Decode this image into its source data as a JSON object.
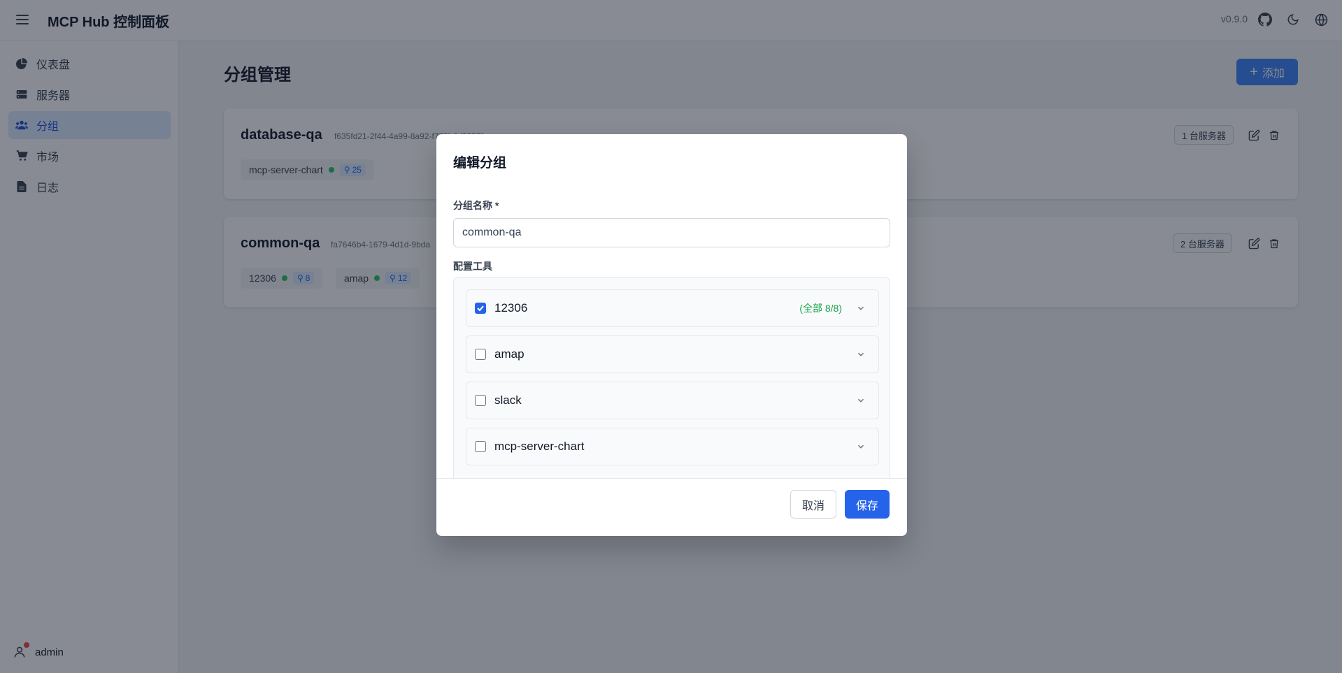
{
  "header": {
    "title": "MCP Hub 控制面板",
    "version": "v0.9.0"
  },
  "sidebar": {
    "items": [
      {
        "label": "仪表盘",
        "icon": "pie-chart-icon"
      },
      {
        "label": "服务器",
        "icon": "server-icon"
      },
      {
        "label": "分组",
        "icon": "users-icon",
        "active": true
      },
      {
        "label": "市场",
        "icon": "cart-icon"
      },
      {
        "label": "日志",
        "icon": "document-icon"
      }
    ],
    "user": "admin"
  },
  "main": {
    "title": "分组管理",
    "add_label": "添加",
    "groups": [
      {
        "name": "database-qa",
        "id": "f635fd21-2f44-4a99-8a92-f779b4d9697f",
        "server_count": "1 台服务器",
        "servers": [
          {
            "name": "mcp-server-chart",
            "tools": "25"
          }
        ]
      },
      {
        "name": "common-qa",
        "id": "fa7646b4-1679-4d1d-9bda",
        "server_count": "2 台服务器",
        "servers": [
          {
            "name": "12306",
            "tools": "8"
          },
          {
            "name": "amap",
            "tools": "12"
          }
        ]
      }
    ]
  },
  "modal": {
    "title": "编辑分组",
    "name_label": "分组名称 *",
    "name_value": "common-qa",
    "tools_label": "配置工具",
    "tools": [
      {
        "name": "12306",
        "checked": true,
        "status": "(全部 8/8)"
      },
      {
        "name": "amap",
        "checked": false,
        "status": ""
      },
      {
        "name": "slack",
        "checked": false,
        "status": ""
      },
      {
        "name": "mcp-server-chart",
        "checked": false,
        "status": ""
      }
    ],
    "cancel_label": "取消",
    "save_label": "保存"
  },
  "colors": {
    "accent": "#2563eb",
    "active_nav_bg": "#dbeafe",
    "status_green": "#22c55e",
    "overlay": "rgba(17,24,39,0.5)"
  }
}
